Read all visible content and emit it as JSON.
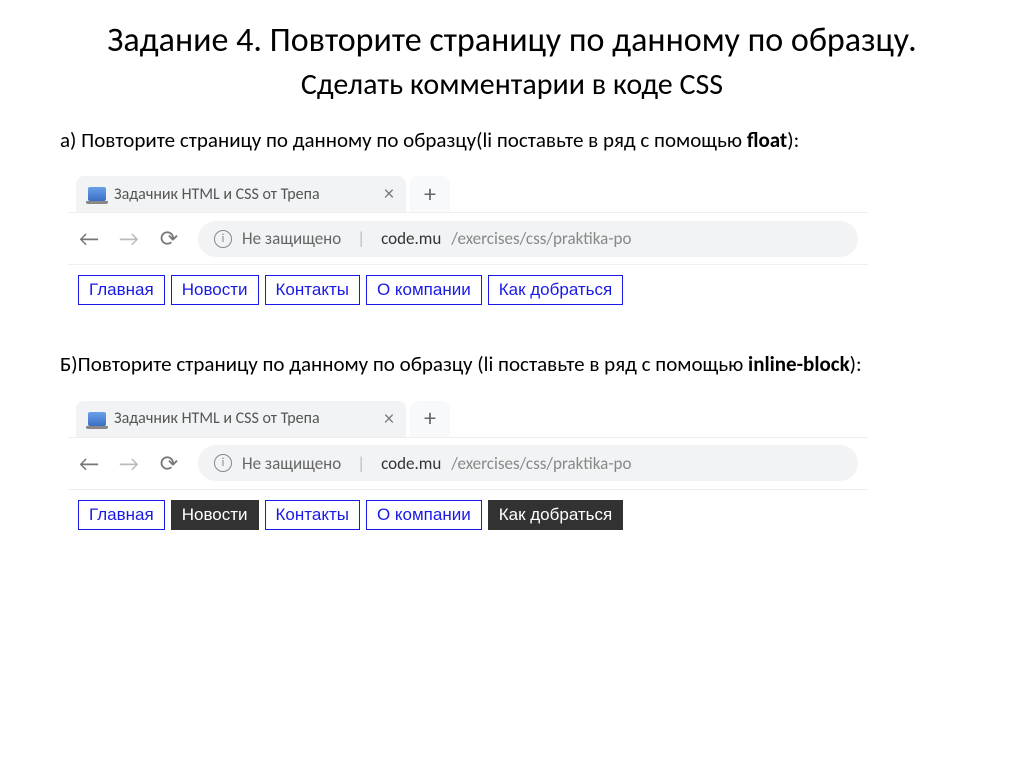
{
  "heading": {
    "main": "Задание 4. Повторите страницу по данному по образцу.",
    "sub": "Сделать комментарии в коде CSS"
  },
  "task_a": {
    "prefix": "а) Повторите страницу по данному по образцу(li поставьте в ряд с помощью ",
    "bold": "float",
    "suffix": "):"
  },
  "task_b": {
    "prefix": "Б)Повторите страницу по данному по образцу (li поставьте в ряд с помощью ",
    "bold": "inline-block",
    "suffix": "):"
  },
  "browser": {
    "tab_title": "Задачник HTML и CSS от Трепа",
    "close_glyph": "×",
    "plus_glyph": "+",
    "back_glyph": "←",
    "forward_glyph": "→",
    "reload_glyph": "⟳",
    "info_glyph": "i",
    "not_secure": "Не защищено",
    "domain": "code.mu",
    "path": "/exercises/css/praktika-po"
  },
  "menu_a": [
    "Главная",
    "Новости",
    "Контакты",
    "О компании",
    "Как добраться"
  ],
  "menu_b": [
    {
      "label": "Главная",
      "dark": false
    },
    {
      "label": "Новости",
      "dark": true
    },
    {
      "label": "Контакты",
      "dark": false
    },
    {
      "label": "О компании",
      "dark": false
    },
    {
      "label": "Как добраться",
      "dark": true
    }
  ]
}
